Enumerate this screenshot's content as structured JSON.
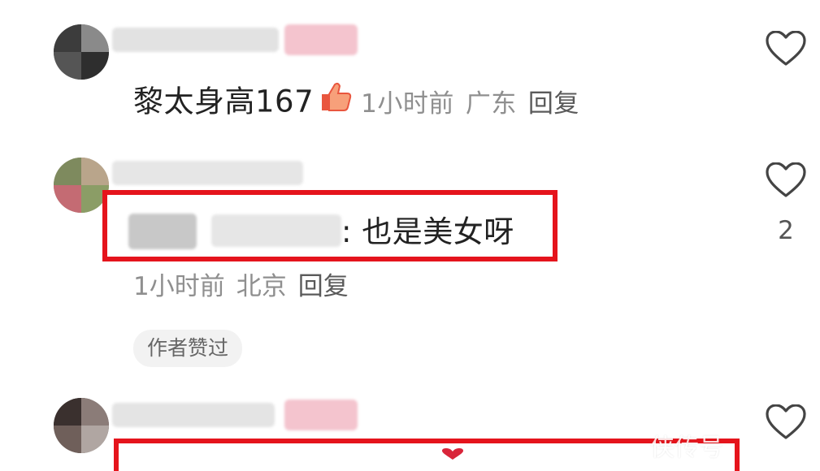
{
  "comments": [
    {
      "text": "黎太身高167",
      "time": "1小时前",
      "location": "广东",
      "reply": "回复"
    },
    {
      "text": ": 也是美女呀",
      "time": "1小时前",
      "location": "北京",
      "reply": "回复",
      "like_count": "2",
      "author_liked": "作者赞过"
    }
  ],
  "watermark": "侠传号"
}
